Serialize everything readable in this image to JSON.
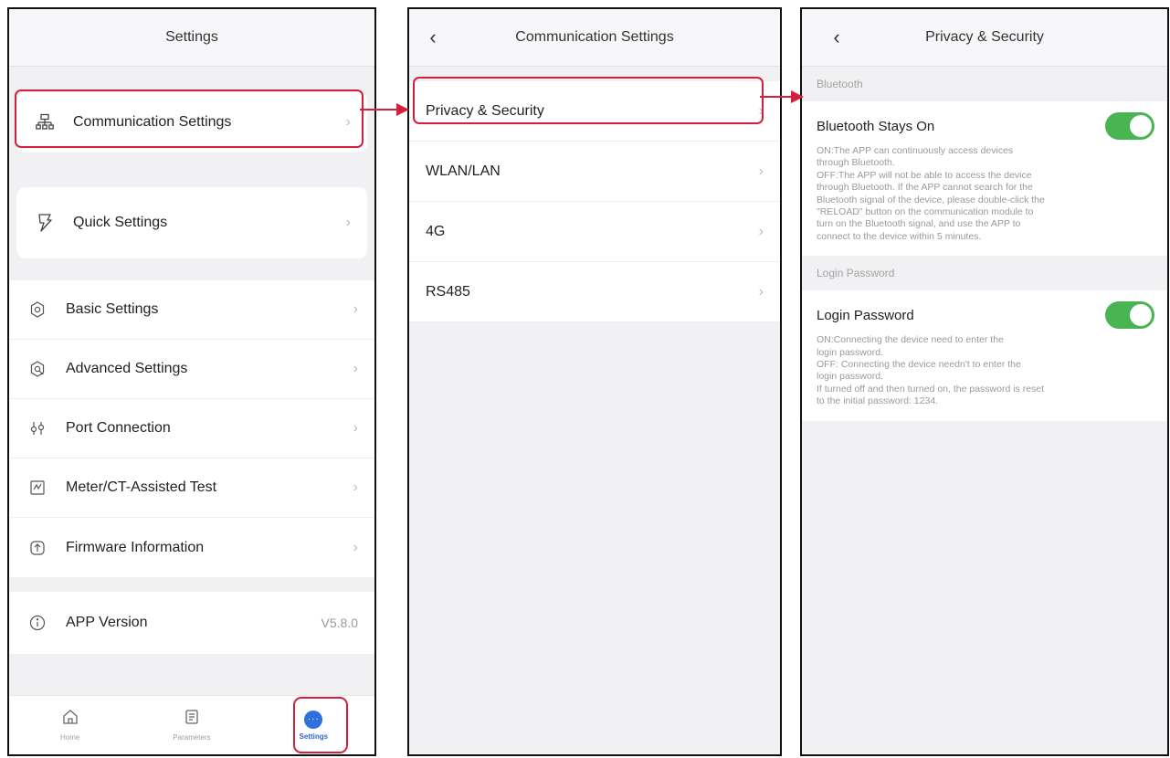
{
  "settings_screen": {
    "title": "Settings",
    "communication_item": "Communication Settings",
    "quick_item": "Quick Settings",
    "menu": [
      {
        "label": "Basic Settings",
        "icon": "gear-icon"
      },
      {
        "label": "Advanced Settings",
        "icon": "advanced-gear-icon"
      },
      {
        "label": "Port Connection",
        "icon": "port-icon"
      },
      {
        "label": "Meter/CT-Assisted Test",
        "icon": "meter-test-icon"
      },
      {
        "label": "Firmware Information",
        "icon": "firmware-upload-icon"
      }
    ],
    "app_version_label": "APP Version",
    "app_version_value": "V5.8.0",
    "tabs": [
      {
        "label": "Home",
        "icon": "home-icon"
      },
      {
        "label": "Parameters",
        "icon": "parameters-icon"
      },
      {
        "label": "Settings",
        "icon": "settings-dots-icon"
      }
    ],
    "active_tab": "Settings"
  },
  "communication_screen": {
    "back_glyph": "‹",
    "title": "Communication Settings",
    "items": [
      "Privacy & Security",
      "WLAN/LAN",
      "4G",
      "RS485"
    ]
  },
  "privacy_screen": {
    "back_glyph": "‹",
    "title": "Privacy & Security",
    "bluetooth_section": "Bluetooth",
    "bluetooth_toggle_label": "Bluetooth Stays On",
    "bluetooth_toggle_on": true,
    "bluetooth_desc": "ON:The APP can continuously access devices\nthrough Bluetooth.\nOFF:The APP will not be able to access the device\nthrough Bluetooth. If the APP cannot search for the\nBluetooth signal of the device, please double-click the\n\"RELOAD\" button on the communication module to\nturn on the Bluetooth signal, and use the APP to\nconnect to the device within 5 minutes.",
    "login_section": "Login Password",
    "login_toggle_label": "Login Password",
    "login_toggle_on": true,
    "login_desc": "ON:Connecting the device need to enter the\nlogin password.\nOFF: Connecting the device needn't to enter the\nlogin password.\nIf turned off and then turned on, the password is reset\nto the initial password: 1234."
  },
  "colors": {
    "highlight": "#d21f3c",
    "toggle_on": "#49b452",
    "active_tab": "#2f6fe0"
  }
}
